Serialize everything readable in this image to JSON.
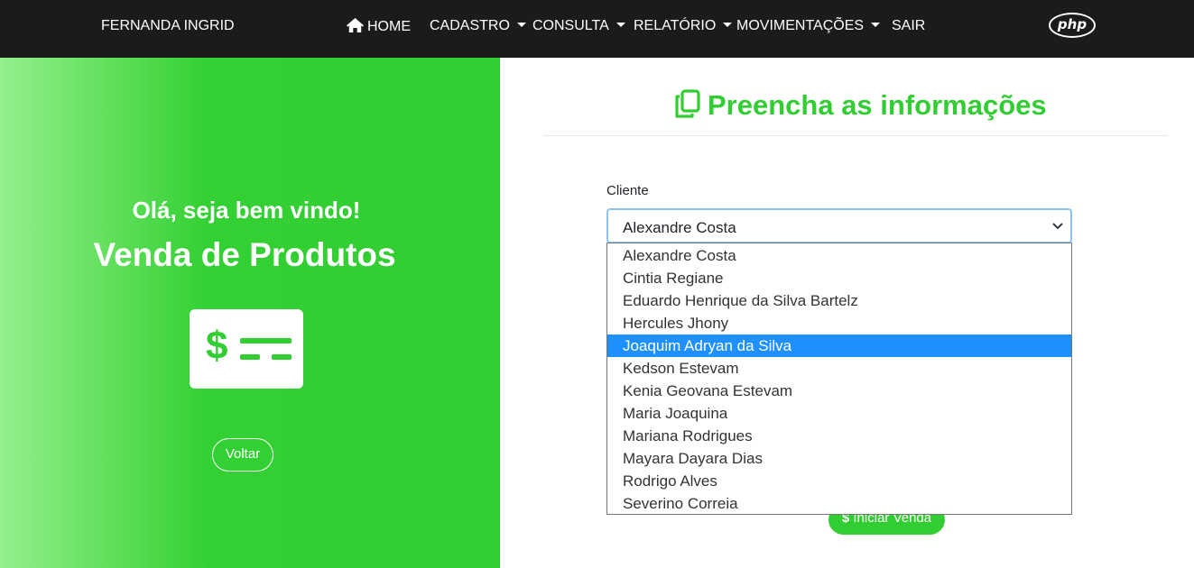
{
  "navbar": {
    "brand": "FERNANDA INGRID",
    "items": [
      {
        "label": "HOME",
        "icon": "home-icon"
      },
      {
        "label": "CADASTRO",
        "dropdown": true
      },
      {
        "label": "CONSULTA",
        "dropdown": true
      },
      {
        "label": "RELATÓRIO",
        "dropdown": true
      },
      {
        "label": "MOVIMENTAÇÕES",
        "dropdown": true
      },
      {
        "label": "SAIR"
      }
    ],
    "logo_text": "php"
  },
  "hero": {
    "greeting": "Olá, seja bem vindo!",
    "title": "Venda de Produtos",
    "icon": "money-check-icon",
    "back_label": "Voltar"
  },
  "form": {
    "title": "Preencha as informações",
    "title_icon": "copy-icon",
    "client_label": "Cliente",
    "client_selected": "Alexandre Costa",
    "client_options": [
      "Alexandre Costa",
      "Cintia Regiane",
      "Eduardo Henrique da Silva Bartelz",
      "Hercules Jhony",
      "Joaquim Adryan da Silva",
      "Kedson Estevam",
      "Kenia Geovana Estevam",
      "Maria Joaquina",
      "Mariana Rodrigues",
      "Mayara Dayara Dias",
      "Rodrigo Alves",
      "Severino Correia"
    ],
    "highlighted_option": "Joaquim Adryan da Silva",
    "start_label": "Iniciar Venda"
  },
  "colors": {
    "accent": "#32cd32",
    "navbar": "#1b1b1b",
    "highlight": "#1e90ff"
  }
}
